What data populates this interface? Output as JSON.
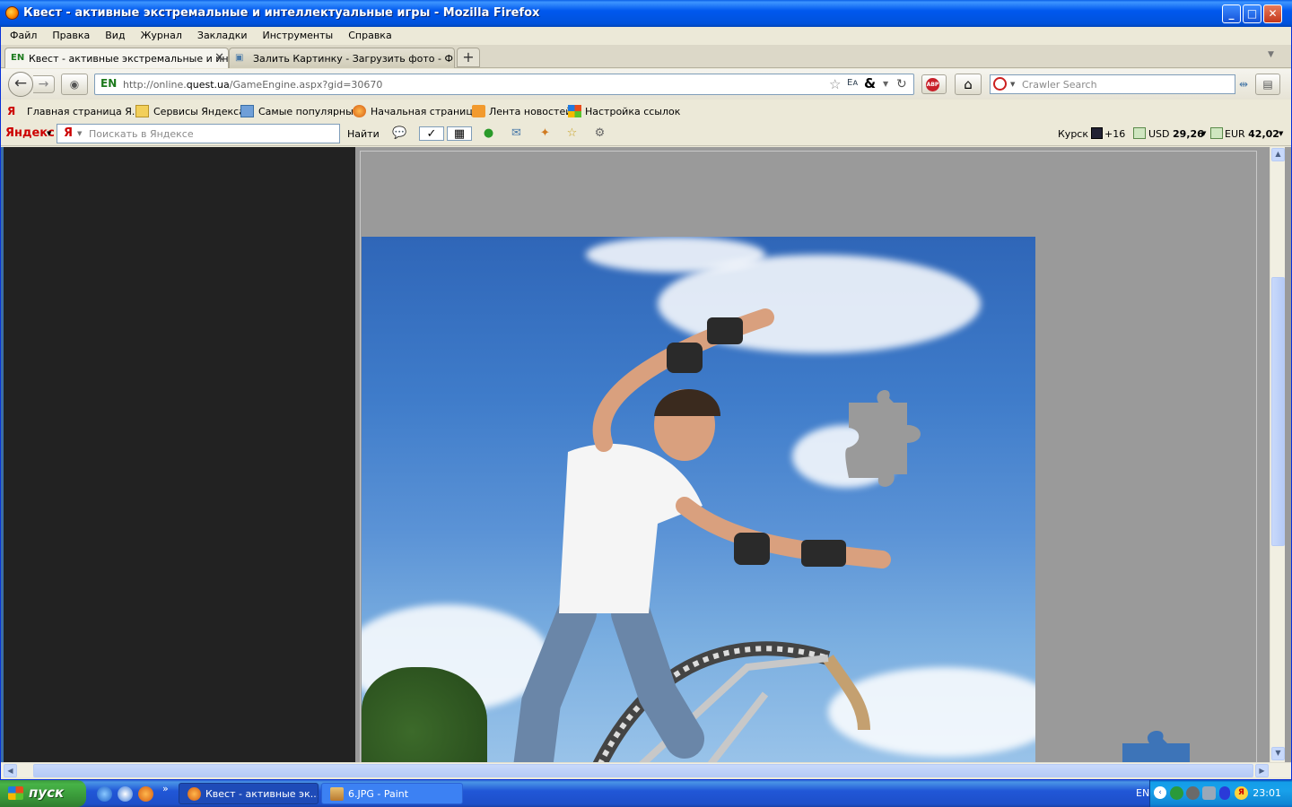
{
  "window": {
    "title": "Квест - активные экстремальные и интеллектуальные игры - Mozilla Firefox",
    "btn_minimize": "_",
    "btn_maximize": "□",
    "btn_close": "✕"
  },
  "menu": [
    "Файл",
    "Правка",
    "Вид",
    "Журнал",
    "Закладки",
    "Инструменты",
    "Справка"
  ],
  "tabs": [
    {
      "label": "Квест - активные экстремальные и ин...",
      "active": true
    },
    {
      "label": "Залить Картинку - Загрузить фото - Ф...",
      "active": false
    }
  ],
  "tab_close": "✕",
  "new_tab": "+",
  "nav": {
    "site_badge": "EN",
    "url_prefix": "http://online.",
    "url_domain": "quest.ua",
    "url_path": "/GameEngine.aspx?gid=30670",
    "search_placeholder": "Crawler Search"
  },
  "bookmarks": [
    {
      "label": "Главная страница Я...",
      "icon": "yandex-icon"
    },
    {
      "label": "Сервисы Яндекса",
      "icon": "folder-icon"
    },
    {
      "label": "Самые популярные",
      "icon": "search-folder-icon"
    },
    {
      "label": "Начальная страница",
      "icon": "firefox-icon"
    },
    {
      "label": "Лента новостей",
      "icon": "rss-icon"
    },
    {
      "label": "Настройка ссылок",
      "icon": "windows-icon"
    }
  ],
  "yandex": {
    "logo": "Яндекс",
    "placeholder": "Поискать в Яндексе",
    "find": "Найти",
    "city": "Курск",
    "temp": "+16",
    "usd_label": "USD",
    "usd_value": "29,26",
    "eur_label": "EUR",
    "eur_value": "42,02"
  },
  "taskbar": {
    "start": "пуск",
    "tasks": [
      {
        "label": "Квест - активные эк...",
        "icon": "firefox-icon",
        "active": true
      },
      {
        "label": "6.JPG - Paint",
        "icon": "paint-icon",
        "active": false
      }
    ],
    "lang": "EN",
    "clock": "23:01",
    "chevron": "»"
  },
  "colors": {
    "titlebar": "#0058ee",
    "start_green": "#3a9a3a",
    "left_panel": "#222222",
    "game_bg": "#9a9a9a",
    "sky": "#3f7cca"
  }
}
